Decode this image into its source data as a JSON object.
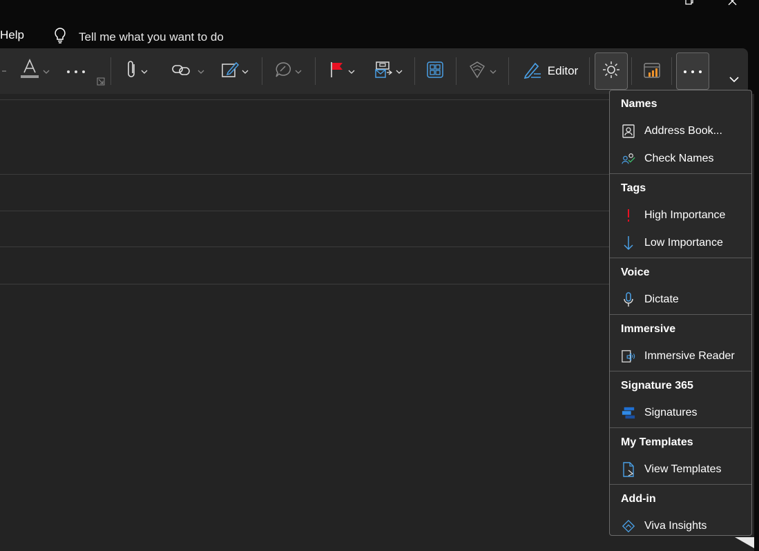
{
  "window": {
    "restore_icon": "restore-icon",
    "close_icon": "close-icon"
  },
  "menu": {
    "help_tab": "Help",
    "tell_me_placeholder": "Tell me what you want to do"
  },
  "ribbon": {
    "editor_label": "Editor",
    "icons": [
      "font-color-icon",
      "more-formatting-icon",
      "attach-file-icon",
      "link-icon",
      "signature-icon",
      "comment-icon",
      "follow-up-flag-icon",
      "sensitivity-icon",
      "apps-grid-icon",
      "my-templates-icon",
      "editor-icon",
      "immersive-reader-icon",
      "viva-insights-icon",
      "more-options-icon",
      "collapse-ribbon-icon"
    ],
    "colors": {
      "flag_red": "#e81123",
      "accent_blue": "#4aa0e6",
      "insights_orange": "#f0932b"
    }
  },
  "dropdown": {
    "groups": [
      {
        "header": "Names",
        "items": [
          {
            "label": "Address Book...",
            "icon": "address-book-icon"
          },
          {
            "label": "Check Names",
            "icon": "check-names-icon"
          }
        ]
      },
      {
        "header": "Tags",
        "items": [
          {
            "label": "High Importance",
            "icon": "high-importance-icon"
          },
          {
            "label": "Low Importance",
            "icon": "low-importance-icon"
          }
        ]
      },
      {
        "header": "Voice",
        "items": [
          {
            "label": "Dictate",
            "icon": "microphone-icon"
          }
        ]
      },
      {
        "header": "Immersive",
        "items": [
          {
            "label": "Immersive Reader",
            "icon": "immersive-reader-icon"
          }
        ]
      },
      {
        "header": "Signature 365",
        "items": [
          {
            "label": "Signatures",
            "icon": "signatures-icon"
          }
        ]
      },
      {
        "header": "My Templates",
        "items": [
          {
            "label": "View Templates",
            "icon": "view-templates-icon"
          }
        ]
      },
      {
        "header": "Add-in",
        "items": [
          {
            "label": "Viva Insights",
            "icon": "viva-insights-icon"
          }
        ]
      }
    ]
  }
}
